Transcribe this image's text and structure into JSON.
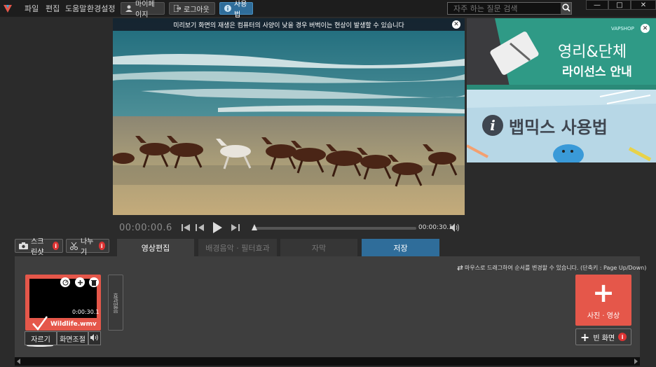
{
  "menu": [
    "파일",
    "편집",
    "도움말",
    "환경설정"
  ],
  "top_buttons": {
    "mypage": "마이페이지",
    "logout": "로그아웃",
    "howto": "사용법"
  },
  "search": {
    "placeholder": "자주 하는 질문 검색"
  },
  "window_controls": {
    "minimize": "—",
    "maximize": "□",
    "close": "✕"
  },
  "preview": {
    "banner": "미리보기 화면의 재생은 컴퓨터의 사양이 낮을 경우 버벅이는 현상이 발생할 수 있습니다",
    "close": "✕"
  },
  "ads": {
    "brand": "VAPSHOP",
    "ad1_line1": "영리&단체",
    "ad1_line2": "라이선스 안내",
    "ad2_text": "뱁믹스 사용법",
    "ad2_info": "i",
    "close": "✕"
  },
  "player": {
    "current_time": "00:00:00.6",
    "end_time": "00:00:30.1",
    "progress": 0.01,
    "icons": [
      "skip-start",
      "step-back",
      "play",
      "step-forward",
      "volume"
    ]
  },
  "left_buttons": {
    "screenshot": "스크린샷",
    "split": "나누기",
    "info": "i"
  },
  "tabs": [
    {
      "label": "영상편집",
      "state": "active"
    },
    {
      "label": "배경음악 · 필터효과",
      "state": "inactive"
    },
    {
      "label": "자막",
      "state": "inactive"
    },
    {
      "label": "저장",
      "state": "highlight"
    }
  ],
  "workspace": {
    "hint": "마우스로 드래그하여 순서를 변경할 수 있습니다.  (단축키 : Page Up/Down)",
    "clip": {
      "name": "Wildlife.wmv",
      "duration": "0:00:30.1",
      "cut": "자르기",
      "screen_adjust": "화면조절"
    },
    "effect_label": "효과없음",
    "add_button": {
      "plus": "+",
      "label": "사진 · 영상"
    },
    "blank_button": {
      "label": "빈 화면",
      "plus": "+"
    }
  },
  "colors": {
    "accent_red": "#e5574a",
    "accent_blue": "#2f6d9a",
    "bg": "#2b2b2b"
  }
}
